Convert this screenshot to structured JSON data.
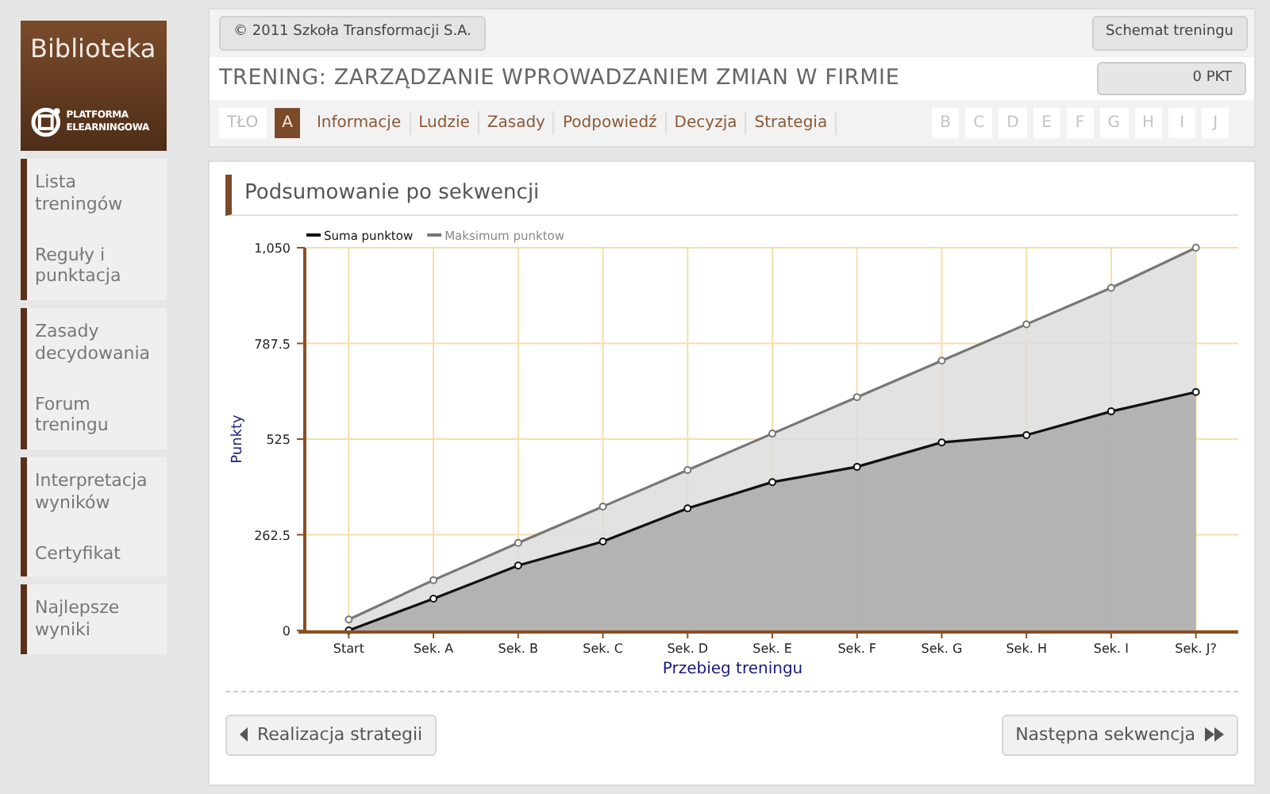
{
  "sidebar": {
    "title": "Biblioteka",
    "logo_text": "PLATFORMA ELEARNINGOWA",
    "groups": [
      {
        "items": [
          "Lista treningów",
          "Reguły i punktacja"
        ]
      },
      {
        "items": [
          "Zasady decydowania",
          "Forum treningu"
        ]
      },
      {
        "items": [
          "Interpretacja wyników",
          "Certyfikat"
        ]
      },
      {
        "items": [
          "Najlepsze wyniki"
        ]
      }
    ]
  },
  "header": {
    "copyright": "© 2011 Szkoła Transformacji S.A.",
    "scheme_button": "Schemat treningu",
    "title": "TRENING: ZARZĄDZANIE WPROWADZANIEM ZMIAN W FIRMIE",
    "points": "0 PKT",
    "tabs": [
      {
        "label": "TŁO",
        "kind": "box",
        "selected": false
      },
      {
        "label": "A",
        "kind": "box",
        "selected": true
      },
      {
        "label": "Informacje",
        "kind": "link",
        "selected": false
      },
      {
        "label": "Ludzie",
        "kind": "link",
        "selected": false
      },
      {
        "label": "Zasady",
        "kind": "link",
        "selected": false
      },
      {
        "label": "Podpowiedź",
        "kind": "link",
        "selected": false
      },
      {
        "label": "Decyzja",
        "kind": "link",
        "selected": false
      },
      {
        "label": "Strategia",
        "kind": "link",
        "selected": false
      }
    ],
    "letters": [
      "B",
      "C",
      "D",
      "E",
      "F",
      "G",
      "H",
      "I",
      "J"
    ]
  },
  "panel": {
    "heading": "Podsumowanie po sekwencji",
    "chart_data": {
      "type": "area",
      "xlabel": "Przebieg treningu",
      "ylabel": "Punkty",
      "categories": [
        "Start",
        "Sek. A",
        "Sek. B",
        "Sek. C",
        "Sek. D",
        "Sek. E",
        "Sek. F",
        "Sek. G",
        "Sek. H",
        "Sek. I",
        "Sek. J?"
      ],
      "series": [
        {
          "name": "Suma punktow",
          "color": "#111111",
          "values": [
            0,
            87,
            178,
            244,
            335,
            407,
            449,
            516,
            536,
            601,
            654
          ]
        },
        {
          "name": "Maksimum punktow",
          "color": "#777777",
          "values": [
            30,
            138,
            240,
            340,
            440,
            540,
            640,
            740,
            840,
            940,
            1050
          ]
        }
      ],
      "grid": true,
      "legend": true,
      "ylim": [
        0,
        1050
      ],
      "yticks": [
        0,
        262.5,
        525,
        787.5,
        {
          "value": 1050,
          "label": "1,050"
        }
      ]
    },
    "prev_button": "Realizacja strategii",
    "next_button": "Następna sekwencja"
  }
}
